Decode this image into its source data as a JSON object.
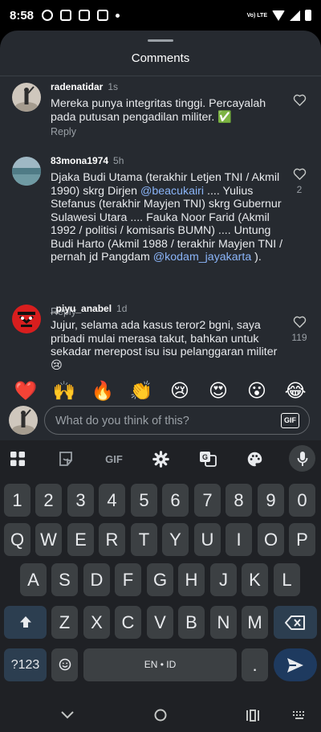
{
  "status_bar": {
    "time": "8:58",
    "network_label": "Vo) LTE"
  },
  "sheet": {
    "title": "Comments"
  },
  "comments": [
    {
      "username": "radenatidar",
      "time": "1s",
      "text": "Mereka punya integritas tinggi. Percayalah pada putusan pengadilan militer. ✅",
      "reply_label": "Reply",
      "likes": ""
    },
    {
      "username": "83mona1974",
      "time": "5h",
      "text_part1": "Djaka Budi Utama (terakhir Letjen TNI / Akmil 1990) skrg Dirjen ",
      "mention1": "@beacukairi",
      "text_part2": " .... Yulius Stefanus (terakhir Mayjen TNI) skrg Gubernur Sulawesi Utara .... Fauka Noor Farid (Akmil 1992 / politisi / komisaris BUMN) .... Untung Budi Harto (Akmil 1988 / terakhir Mayjen TNI / pernah jd Pangdam ",
      "mention2": "@kodam_jayakarta",
      "text_part3": " ).",
      "reply_label": "Reply",
      "likes": "2"
    },
    {
      "username": "_piyu_anabel",
      "time": "1d",
      "text": "Jujur, selama ada kasus teror2 bgni, saya pribadi mulai merasa takut, bahkan untuk sekadar merepost isu isu pelanggaran militer 😢",
      "likes": "119"
    }
  ],
  "emoji_bar": [
    "❤️",
    "🙌",
    "🔥",
    "👏",
    "😢",
    "😍",
    "😮",
    "😂"
  ],
  "compose": {
    "placeholder": "What do you think of this?",
    "gif_label": "GIF"
  },
  "keyboard": {
    "toolbar_gif_label": "GIF",
    "row_numbers": [
      "1",
      "2",
      "3",
      "4",
      "5",
      "6",
      "7",
      "8",
      "9",
      "0"
    ],
    "row1": [
      "Q",
      "W",
      "E",
      "R",
      "T",
      "Y",
      "U",
      "I",
      "O",
      "P"
    ],
    "row2": [
      "A",
      "S",
      "D",
      "F",
      "G",
      "H",
      "J",
      "K",
      "L"
    ],
    "row3": [
      "Z",
      "X",
      "C",
      "V",
      "B",
      "N",
      "M"
    ],
    "symbols_label": "?123",
    "space_label": "EN • ID",
    "period_label": "."
  },
  "colors": {
    "sheet_bg": "#262a30",
    "keyboard_bg": "#1f2125",
    "mention": "#8ab4f8",
    "key_bg": "#3c4043"
  }
}
